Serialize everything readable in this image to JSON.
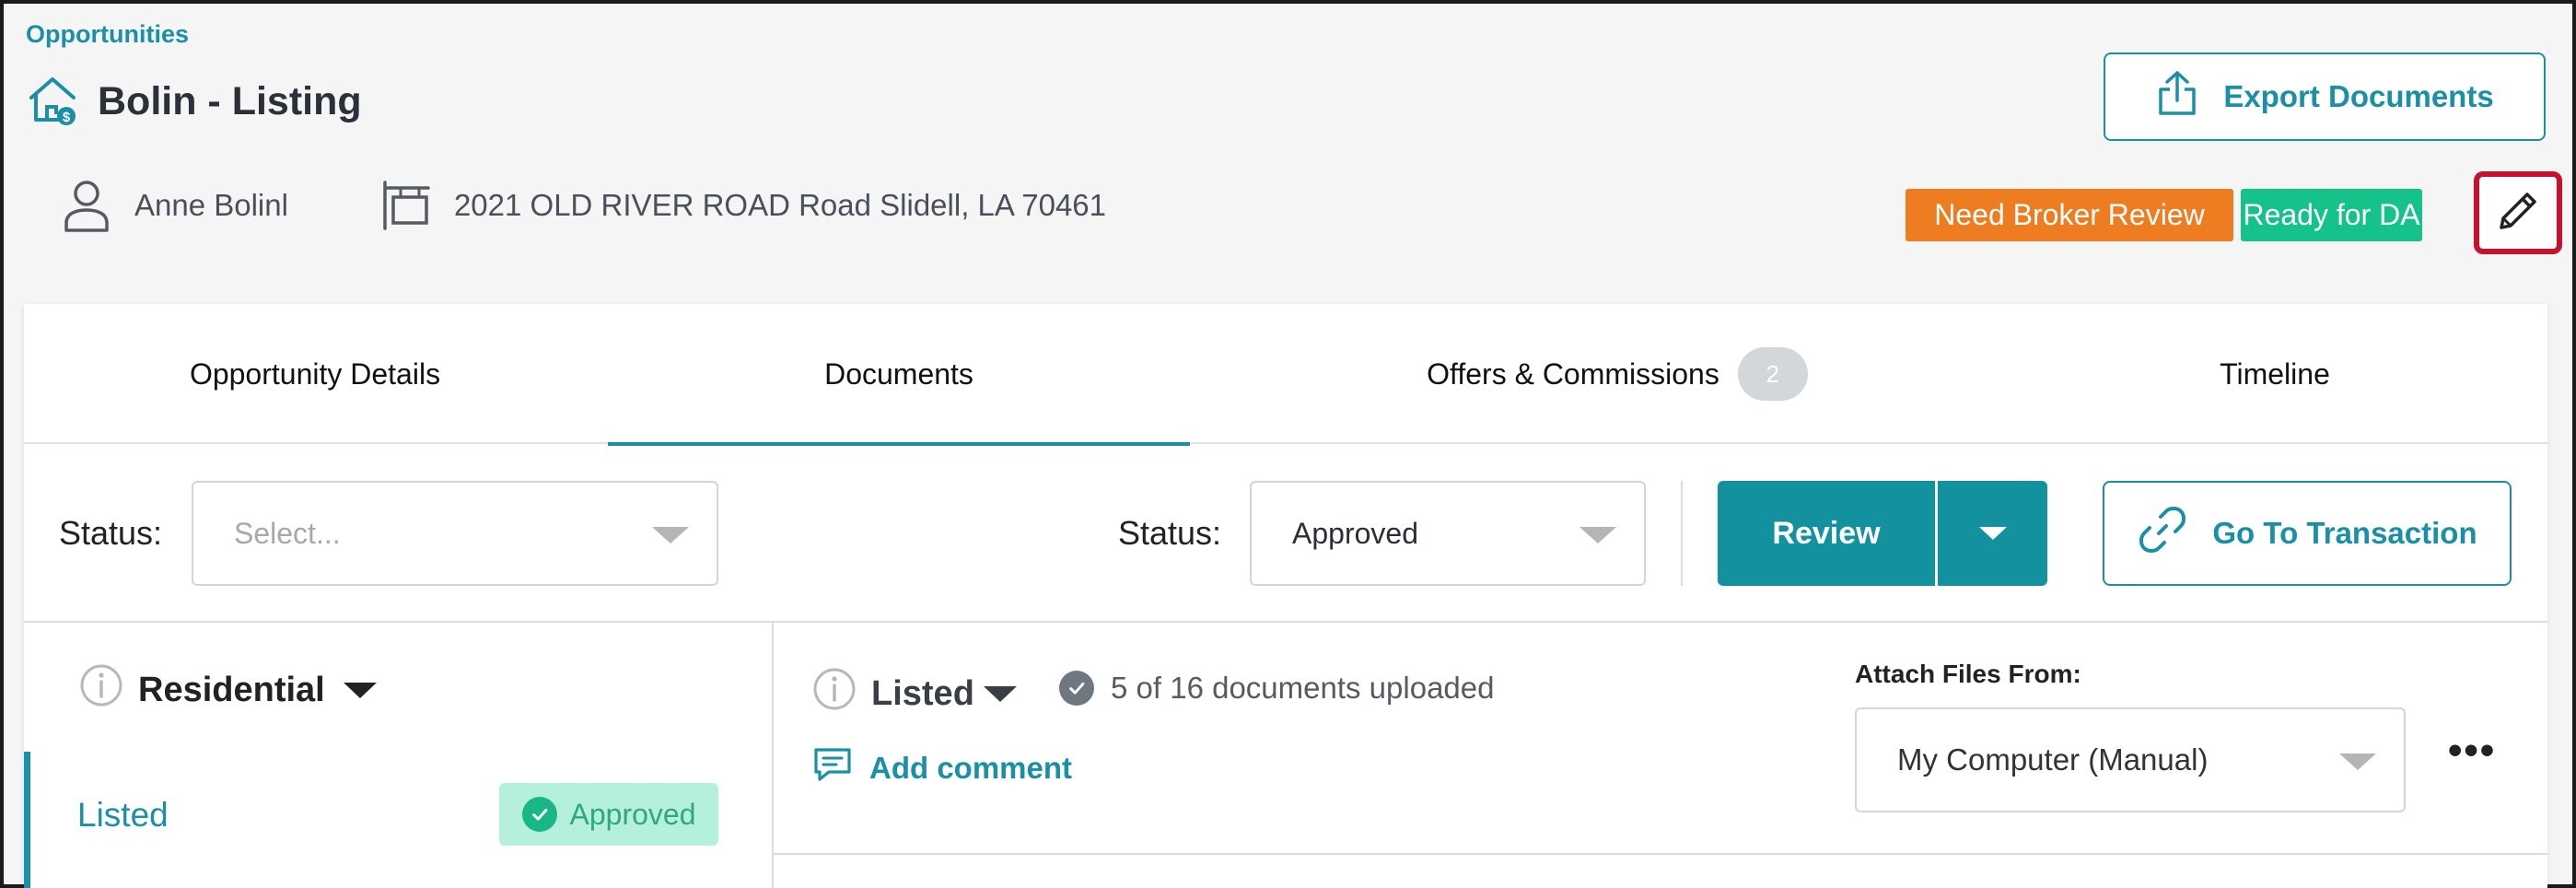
{
  "breadcrumb": "Opportunities",
  "page_title": "Bolin - Listing",
  "actions": {
    "export_label": "Export Documents"
  },
  "meta": {
    "agent_name": "Anne Bolinl",
    "address": "2021 OLD RIVER ROAD Road Slidell, LA 70461"
  },
  "badges": {
    "broker_review": "Need Broker Review",
    "ready": "Ready for DA"
  },
  "tabs": [
    {
      "label": "Opportunity Details"
    },
    {
      "label": "Documents",
      "active": true
    },
    {
      "label": "Offers & Commissions",
      "count": "2"
    },
    {
      "label": "Timeline"
    }
  ],
  "filters": {
    "status_label_1": "Status:",
    "status_placeholder": "Select...",
    "status_label_2": "Status:",
    "status_value": "Approved"
  },
  "buttons": {
    "review": "Review",
    "go_to_transaction": "Go To Transaction"
  },
  "left_panel": {
    "category": "Residential",
    "item_label": "Listed",
    "item_status": "Approved"
  },
  "right_panel": {
    "stage": "Listed",
    "doc_count": "5 of 16 documents uploaded",
    "add_comment": "Add comment",
    "attach_label": "Attach Files From:",
    "attach_value": "My Computer (Manual)"
  },
  "colors": {
    "accent": "#1a8fa6",
    "primary_button": "#14919f",
    "badge_orange": "#ee7d22",
    "badge_green": "#14c28a",
    "highlight": "#c4122f",
    "approved_bg": "#b5f0dd"
  }
}
